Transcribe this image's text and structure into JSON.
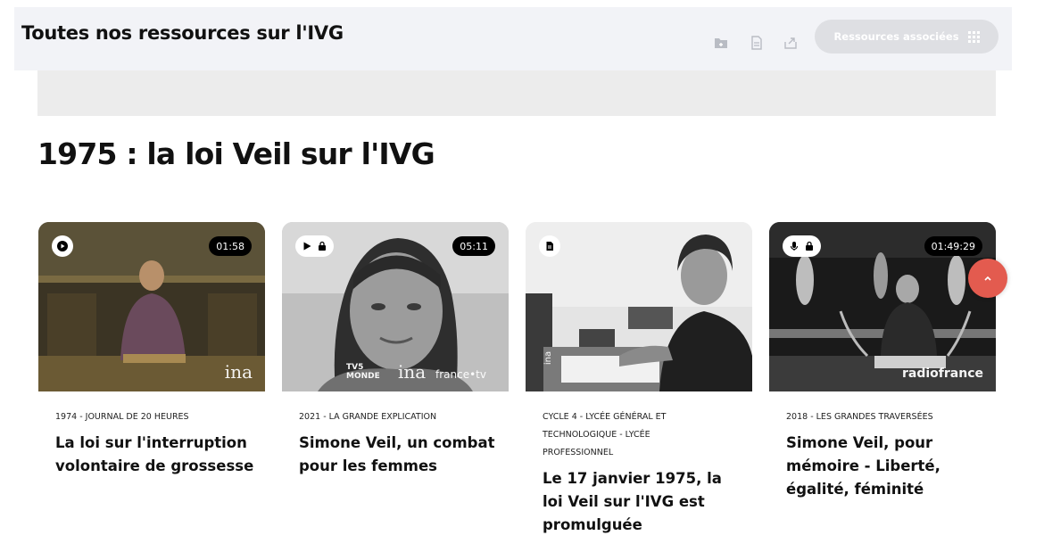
{
  "header": {
    "title": "Toutes nos ressources sur l'IVG",
    "tools": [
      "folder-add-icon",
      "document-icon",
      "share-icon"
    ],
    "associated_label": "Ressources associées"
  },
  "section": {
    "title": "1975 : la loi Veil sur l'IVG"
  },
  "cards": [
    {
      "media": "video",
      "locked": false,
      "duration": "01:58",
      "brands": [
        "ina"
      ],
      "meta": "1974 - JOURNAL DE 20 HEURES",
      "title": "La loi sur l'interruption volontaire de grossesse"
    },
    {
      "media": "video",
      "locked": true,
      "duration": "05:11",
      "brands": [
        "TV5 MONDE",
        "ina",
        "france•tv"
      ],
      "meta": "2021 - LA GRANDE EXPLICATION",
      "title": "Simone Veil, un combat pour les femmes"
    },
    {
      "media": "document",
      "locked": false,
      "duration": "",
      "brands": [
        "ina"
      ],
      "meta": "CYCLE 4 - LYCÉE GÉNÉRAL ET TECHNOLOGIQUE - LYCÉE PROFESSIONNEL",
      "title": "Le 17 janvier 1975, la loi Veil sur l'IVG est promulguée"
    },
    {
      "media": "audio",
      "locked": true,
      "duration": "01:49:29",
      "brands": [
        "radiofrance"
      ],
      "meta": "2018 - LES GRANDES TRAVERSÉES",
      "title": "Simone Veil, pour mémoire - Liberté, égalité, féminité"
    }
  ],
  "colors": {
    "accent": "#e35b4f",
    "topbar_bg": "#f2f3f7",
    "button_bg": "#dedfe3"
  }
}
